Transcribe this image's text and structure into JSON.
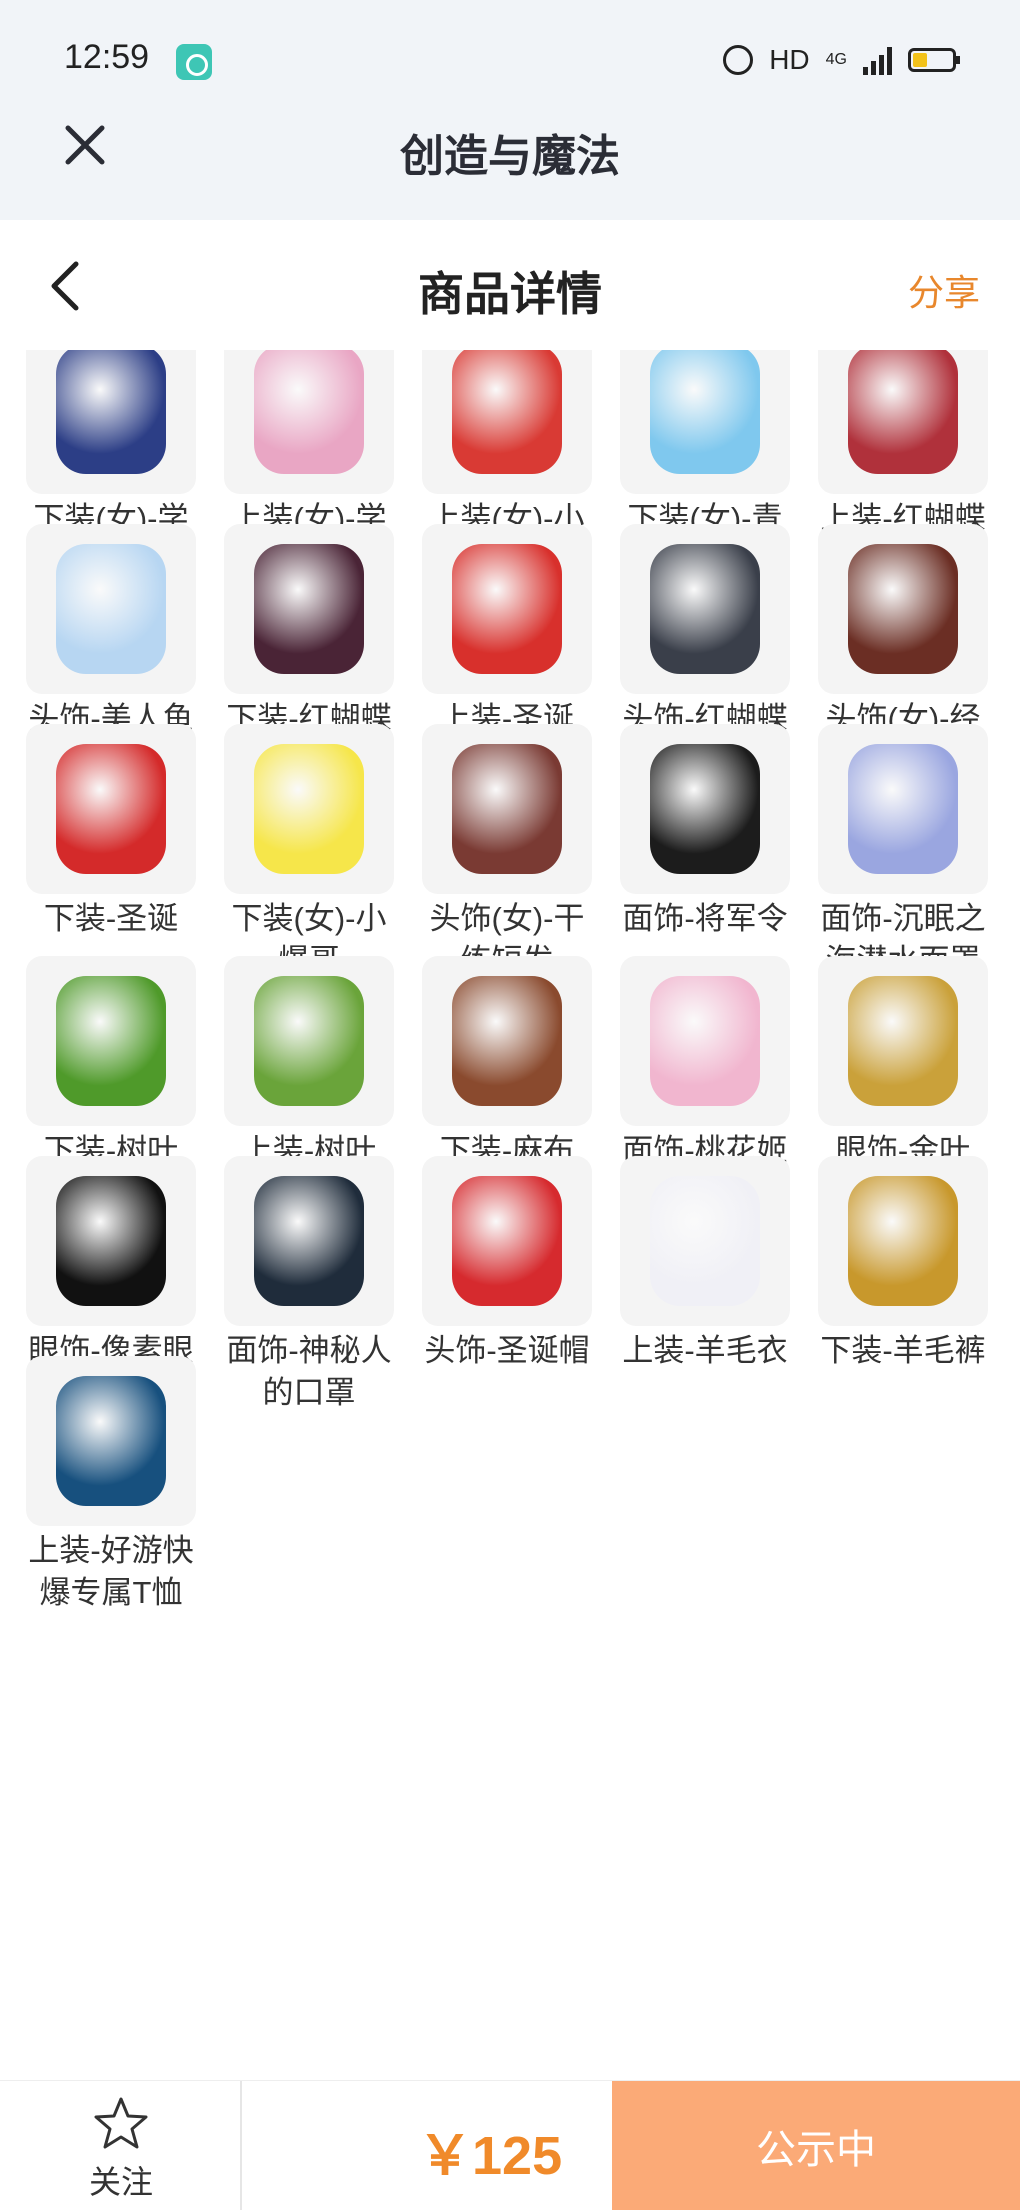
{
  "status_bar": {
    "time": "12:59",
    "network": "HD",
    "cell": "4G"
  },
  "app": {
    "title": "创造与魔法"
  },
  "header": {
    "title": "商品详情",
    "share_label": "分享"
  },
  "items": [
    {
      "label": "下装(女)-学园日记",
      "color": "#2c3e86"
    },
    {
      "label": "上装(女)-学园日记",
      "color": "#e9a6c4"
    },
    {
      "label": "上装(女)-小爆哥",
      "color": "#d93a34"
    },
    {
      "label": "下装(女)-青萝",
      "color": "#7fc8ee"
    },
    {
      "label": "上装-红蝴蝶衣",
      "color": "#b0313b"
    },
    {
      "label": "头饰-美人鱼之冠",
      "color": "#b7d6f2"
    },
    {
      "label": "下装-红蝴蝶裤",
      "color": "#4a2436"
    },
    {
      "label": "上装-圣诞",
      "color": "#d8302c"
    },
    {
      "label": "头饰-红蝴蝶头冠",
      "color": "#3a3f4a"
    },
    {
      "label": "头饰(女)-经典长发",
      "color": "#6b2e24"
    },
    {
      "label": "下装-圣诞",
      "color": "#d42a2a"
    },
    {
      "label": "下装(女)-小爆哥",
      "color": "#f6e64a"
    },
    {
      "label": "头饰(女)-干练短发",
      "color": "#7a3a33"
    },
    {
      "label": "面饰-将军令",
      "color": "#1c1c1c"
    },
    {
      "label": "面饰-沉眠之海潜水面罩",
      "color": "#9aa6e0"
    },
    {
      "label": "下装-树叶",
      "color": "#4f9a2a"
    },
    {
      "label": "上装-树叶",
      "color": "#6aa43a"
    },
    {
      "label": "下装-麻布",
      "color": "#8a4a2e"
    },
    {
      "label": "面饰-桃花姬",
      "color": "#f1b6cf"
    },
    {
      "label": "眼饰-金叶",
      "color": "#caa13a"
    },
    {
      "label": "眼饰-像素眼镜",
      "color": "#111111"
    },
    {
      "label": "面饰-神秘人的口罩",
      "color": "#1f2c3b"
    },
    {
      "label": "头饰-圣诞帽",
      "color": "#d62a2e"
    },
    {
      "label": "上装-羊毛衣",
      "color": "#f0f0f6"
    },
    {
      "label": "下装-羊毛裤",
      "color": "#c8982c"
    },
    {
      "label": "上装-好游快爆专属T恤",
      "color": "#17507e"
    }
  ],
  "bottom_bar": {
    "follow_label": "关注",
    "price": "￥125",
    "status_label": "公示中"
  },
  "colors": {
    "accent": "#e8872c",
    "price": "#f08a2a",
    "status_button": "#fbaa77",
    "header_bg": "#f1f4f8"
  }
}
